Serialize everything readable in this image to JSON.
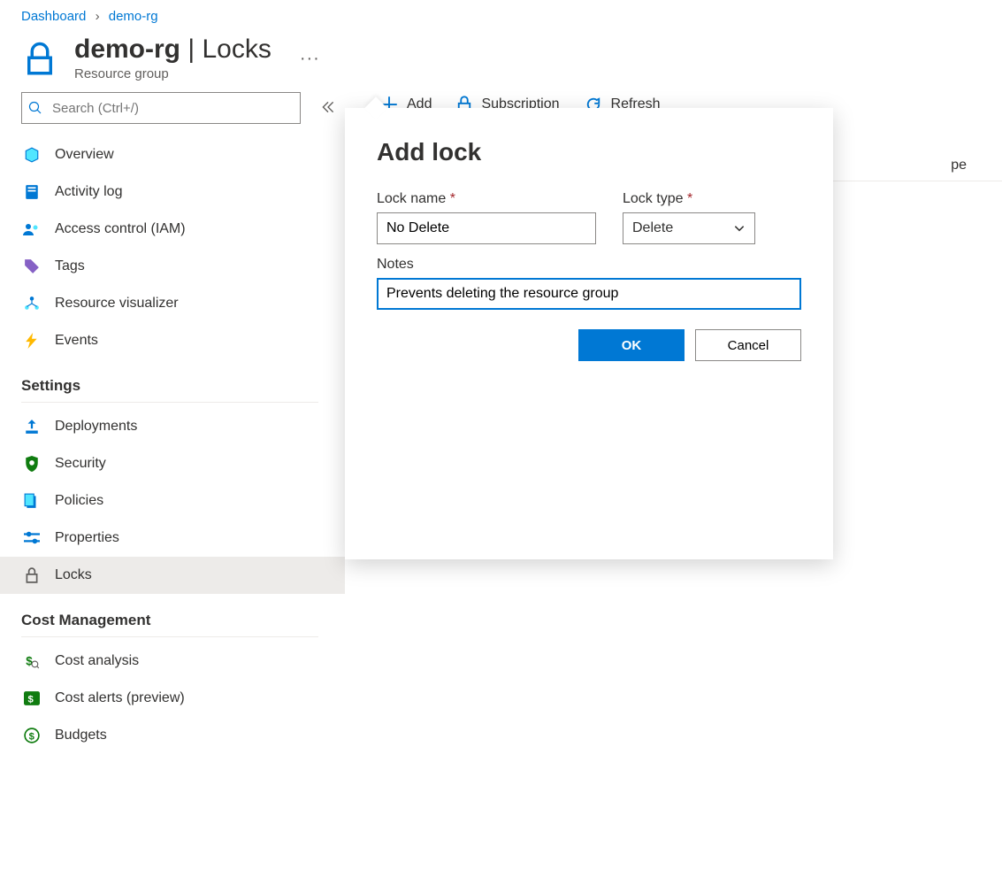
{
  "breadcrumb": {
    "items": [
      "Dashboard",
      "demo-rg"
    ]
  },
  "header": {
    "title_main": "demo-rg",
    "title_sep": " | ",
    "title_page": "Locks",
    "subtitle": "Resource group"
  },
  "search": {
    "placeholder": "Search (Ctrl+/)"
  },
  "sidebar": {
    "top": [
      {
        "label": "Overview",
        "icon": "overview"
      },
      {
        "label": "Activity log",
        "icon": "activity"
      },
      {
        "label": "Access control (IAM)",
        "icon": "iam"
      },
      {
        "label": "Tags",
        "icon": "tags"
      },
      {
        "label": "Resource visualizer",
        "icon": "visualizer"
      },
      {
        "label": "Events",
        "icon": "events"
      }
    ],
    "settings_heading": "Settings",
    "settings": [
      {
        "label": "Deployments",
        "icon": "deployments"
      },
      {
        "label": "Security",
        "icon": "security"
      },
      {
        "label": "Policies",
        "icon": "policies"
      },
      {
        "label": "Properties",
        "icon": "properties"
      },
      {
        "label": "Locks",
        "icon": "locks",
        "active": true
      }
    ],
    "cost_heading": "Cost Management",
    "cost": [
      {
        "label": "Cost analysis",
        "icon": "costanalysis"
      },
      {
        "label": "Cost alerts (preview)",
        "icon": "costalerts"
      },
      {
        "label": "Budgets",
        "icon": "budgets"
      }
    ]
  },
  "toolbar": {
    "add": "Add",
    "subscription": "Subscription",
    "refresh": "Refresh"
  },
  "table": {
    "scope_col_partial": "pe"
  },
  "dialog": {
    "title": "Add lock",
    "lock_name_label": "Lock name",
    "lock_name_value": "No Delete",
    "lock_type_label": "Lock type",
    "lock_type_value": "Delete",
    "notes_label": "Notes",
    "notes_value": "Prevents deleting the resource group",
    "ok": "OK",
    "cancel": "Cancel"
  }
}
